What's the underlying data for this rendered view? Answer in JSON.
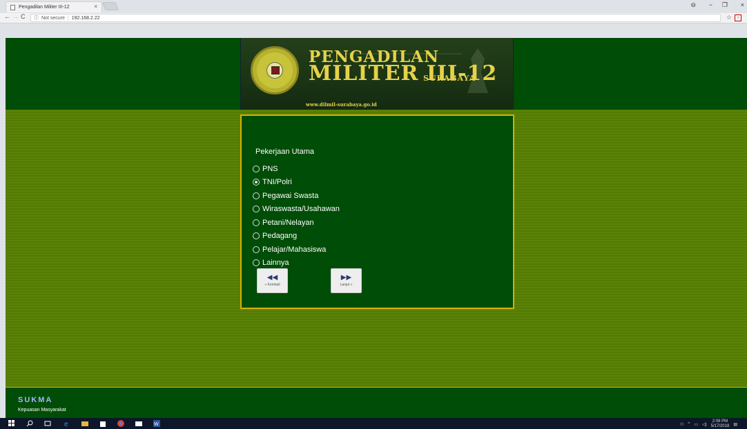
{
  "browser": {
    "tab_title": "Pengadilan Militer III-12",
    "tab_close": "×",
    "address": "192.168.2.22",
    "security_label": "Not secure",
    "window_controls": [
      "−",
      "❐",
      "×"
    ]
  },
  "banner": {
    "title_line1": "PENGADILAN",
    "title_line2": "MILITER III-12",
    "title_line3": "SURABAYA",
    "url": "www.dilmil-surabaya.go.id"
  },
  "form": {
    "question": "Pekerjaan Utama",
    "options": [
      {
        "label": "PNS",
        "selected": false
      },
      {
        "label": "TNI/Polri",
        "selected": true
      },
      {
        "label": "Pegawai Swasta",
        "selected": false
      },
      {
        "label": "Wiraswasta/Usahawan",
        "selected": false
      },
      {
        "label": "Petani/Nelayan",
        "selected": false
      },
      {
        "label": "Pedagang",
        "selected": false
      },
      {
        "label": "Pelajar/Mahasiswa",
        "selected": false
      },
      {
        "label": "Lainnya",
        "selected": false
      }
    ],
    "back_label": "« Kembali",
    "next_label": "Lanjut »"
  },
  "footer": {
    "brand": "SUKMA",
    "subtitle": "Kepuasan Masyarakat"
  },
  "taskbar": {
    "time": "2:08 PM",
    "date": "5/17/2018"
  },
  "colors": {
    "header_green": "#004d07",
    "page_green": "#577f01",
    "gold": "#d7b000"
  }
}
